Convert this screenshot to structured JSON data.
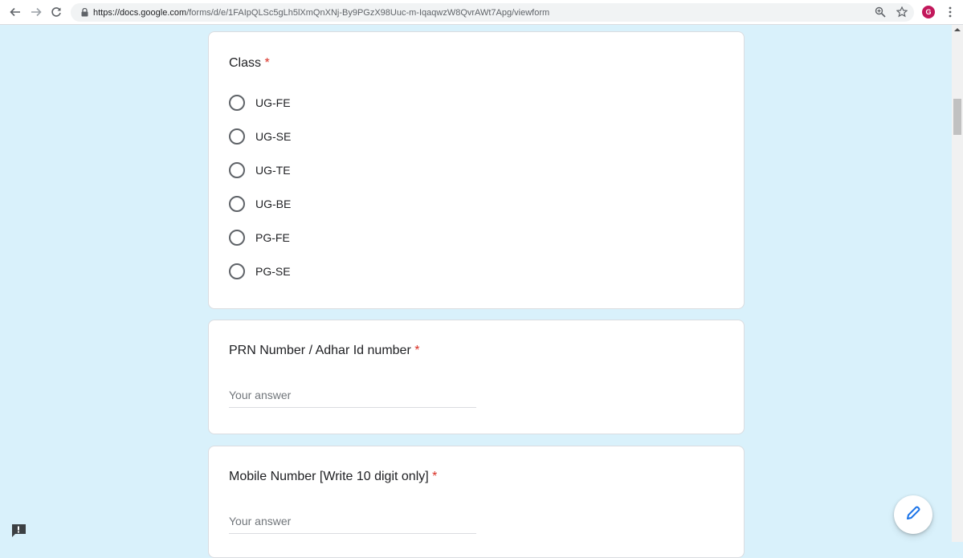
{
  "browser": {
    "url_host": "https://docs.google.com",
    "url_path": "/forms/d/e/1FAIpQLSc5gLh5lXmQnXNj-By9PGzX98Uuc-m-IqaqwzW8QvrAWt7Apg/viewform",
    "avatar_letter": "G",
    "icons": [
      "back-icon",
      "forward-icon",
      "reload-icon",
      "lock-icon",
      "zoom-icon",
      "star-icon",
      "menu-icon"
    ]
  },
  "form": {
    "class_question": {
      "title": "Class",
      "required_mark": "*",
      "options": [
        "UG-FE",
        "UG-SE",
        "UG-TE",
        "UG-BE",
        "PG-FE",
        "PG-SE"
      ]
    },
    "prn_question": {
      "title": "PRN Number / Adhar Id number",
      "required_mark": "*",
      "placeholder": "Your answer"
    },
    "mobile_question": {
      "title": "Mobile Number [Write 10 digit only]",
      "required_mark": "*",
      "placeholder": "Your answer"
    }
  },
  "colors": {
    "background": "#d9f1fb",
    "required": "#d93025",
    "edit_icon": "#1a73e8"
  }
}
